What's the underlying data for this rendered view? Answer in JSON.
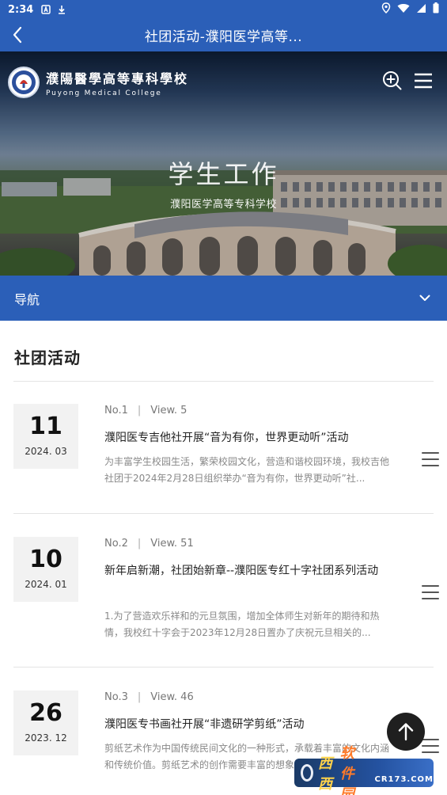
{
  "status_bar": {
    "time": "2:34"
  },
  "header": {
    "title": "社团活动-濮阳医学高等..."
  },
  "hero": {
    "school_name_cn": "濮陽醫學高等專科學校",
    "school_name_en": "Puyong Medical College",
    "title": "学生工作",
    "subtitle": "濮阳医学高等专科学校"
  },
  "nav": {
    "label": "导航"
  },
  "section": {
    "title": "社团活动"
  },
  "items": [
    {
      "day": "11",
      "year_month": "2024. 03",
      "no": "No.1",
      "views": "View. 5",
      "title": "濮阳医专吉他社开展“音为有你，世界更动听”活动",
      "desc": "为丰富学生校园生活，繁荣校园文化，营造和谐校园环境，我校吉他社团于2024年2月28日组织举办“音为有你，世界更动听”社..."
    },
    {
      "day": "10",
      "year_month": "2024. 01",
      "no": "No.2",
      "views": "View. 51",
      "title": "新年启新潮，社团始新章--濮阳医专红十字社团系列活动",
      "desc": "1.为了营造欢乐祥和的元旦氛围，增加全体师生对新年的期待和热情，我校红十字会于2023年12月28日置办了庆祝元旦相关的..."
    },
    {
      "day": "26",
      "year_month": "2023. 12",
      "no": "No.3",
      "views": "View. 46",
      "title": "濮阳医专书画社开展“非遗研学剪纸”活动",
      "desc": "剪纸艺术作为中国传统民间文化的一种形式，承载着丰富的文化内涵和传统价值。剪纸艺术的创作需要丰富的想象力..."
    }
  ],
  "watermark": {
    "part1": "西西",
    "part2": "软件园",
    "part3": "CR173.COM"
  },
  "colors": {
    "primary": "#2b5fb8",
    "date_bg": "#f2f2f2",
    "to_top": "#1f1f1f"
  }
}
